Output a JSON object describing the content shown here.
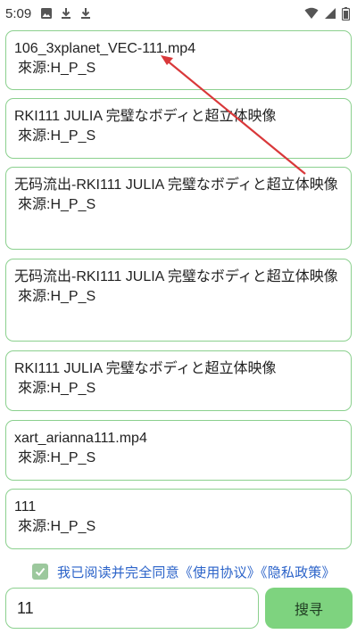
{
  "status_bar": {
    "time": "5:09",
    "left_icons": [
      "image-icon",
      "download-icon",
      "download-icon"
    ],
    "right_icons": [
      "wifi-icon",
      "cellular-signal-icon",
      "battery-icon"
    ]
  },
  "results": [
    {
      "title": "106_3xplanet_VEC-111.mp4",
      "source": "來源:H_P_S"
    },
    {
      "title": "RKI111 JULIA 完璧なボディと超立体映像",
      "source": "來源:H_P_S"
    },
    {
      "title": "无码流出-RKI111 JULIA 完璧なボディと超立体映像",
      "source": "來源:H_P_S"
    },
    {
      "title": "无码流出-RKI111 JULIA 完璧なボディと超立体映像",
      "source": "來源:H_P_S"
    },
    {
      "title": "RKI111 JULIA 完璧なボディと超立体映像",
      "source": "來源:H_P_S"
    },
    {
      "title": "xart_arianna111.mp4",
      "source": "來源:H_P_S"
    },
    {
      "title": "111",
      "source": "來源:H_P_S"
    }
  ],
  "agreement": {
    "checked": true,
    "text": "我已阅读并完全同意《使用协议》《隐私政策》"
  },
  "search": {
    "value": "11",
    "button_label": "搜寻"
  },
  "colors": {
    "card_border": "#8bd08e",
    "button_bg": "#7ed37f",
    "link_blue": "#2b63c9",
    "checkbox": "#9cc89d",
    "annotation_arrow": "#d9383a"
  }
}
